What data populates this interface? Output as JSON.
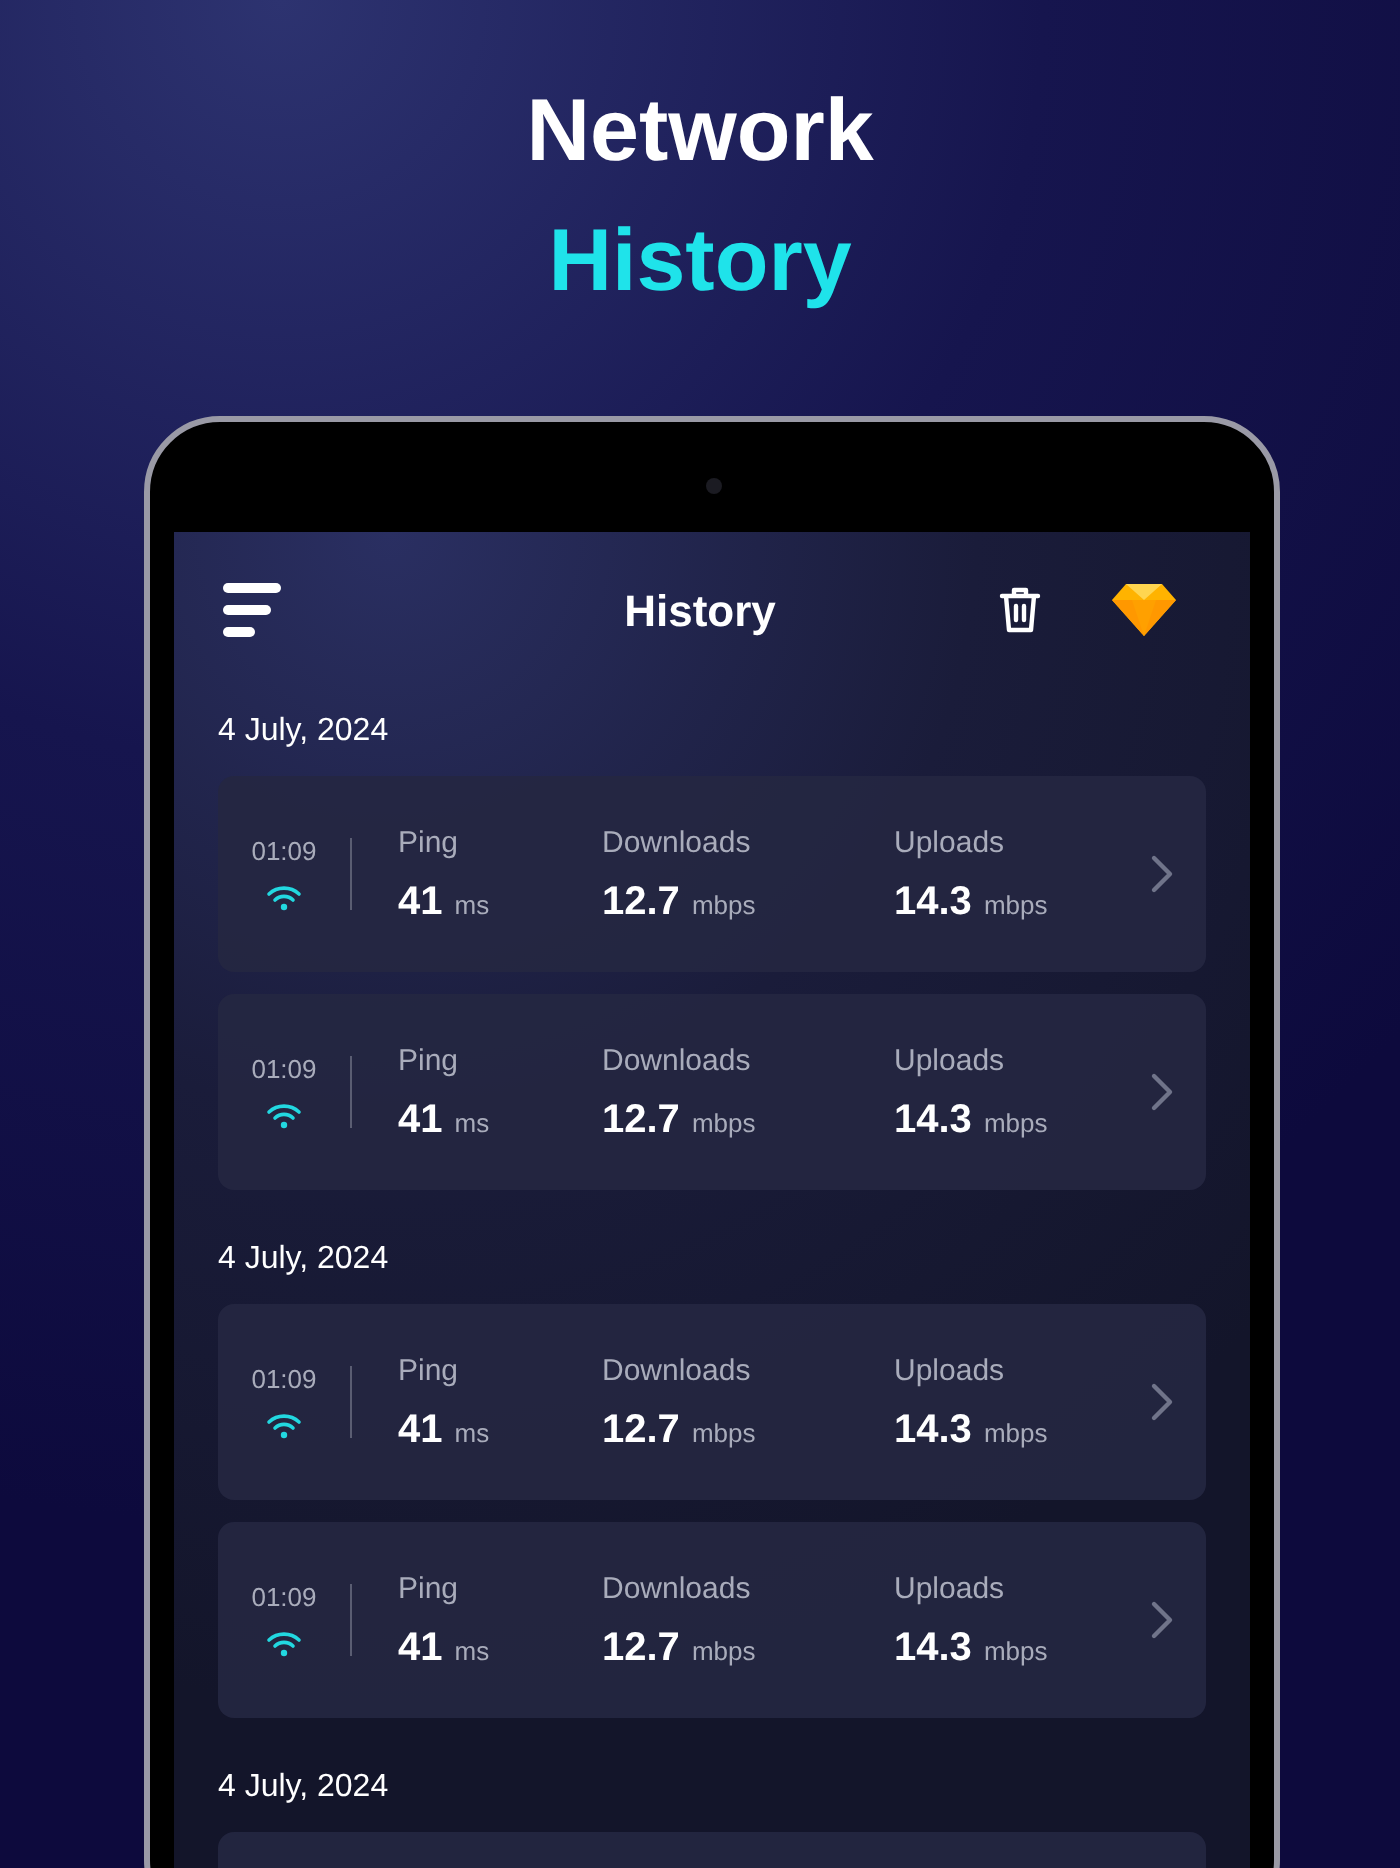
{
  "headline": {
    "line_1": "Network",
    "line_2": "History"
  },
  "app_bar": {
    "title": "History"
  },
  "groups": [
    {
      "date": "4 July, 2024",
      "records": [
        {
          "time": "01:09",
          "ping": {
            "label": "Ping",
            "value": "41",
            "unit": "ms"
          },
          "download": {
            "label": "Downloads",
            "value": "12.7",
            "unit": "mbps"
          },
          "upload": {
            "label": "Uploads",
            "value": "14.3",
            "unit": "mbps"
          }
        },
        {
          "time": "01:09",
          "ping": {
            "label": "Ping",
            "value": "41",
            "unit": "ms"
          },
          "download": {
            "label": "Downloads",
            "value": "12.7",
            "unit": "mbps"
          },
          "upload": {
            "label": "Uploads",
            "value": "14.3",
            "unit": "mbps"
          }
        }
      ]
    },
    {
      "date": "4 July, 2024",
      "records": [
        {
          "time": "01:09",
          "ping": {
            "label": "Ping",
            "value": "41",
            "unit": "ms"
          },
          "download": {
            "label": "Downloads",
            "value": "12.7",
            "unit": "mbps"
          },
          "upload": {
            "label": "Uploads",
            "value": "14.3",
            "unit": "mbps"
          }
        },
        {
          "time": "01:09",
          "ping": {
            "label": "Ping",
            "value": "41",
            "unit": "ms"
          },
          "download": {
            "label": "Downloads",
            "value": "12.7",
            "unit": "mbps"
          },
          "upload": {
            "label": "Uploads",
            "value": "14.3",
            "unit": "mbps"
          }
        }
      ]
    },
    {
      "date": "4 July, 2024"
    }
  ]
}
